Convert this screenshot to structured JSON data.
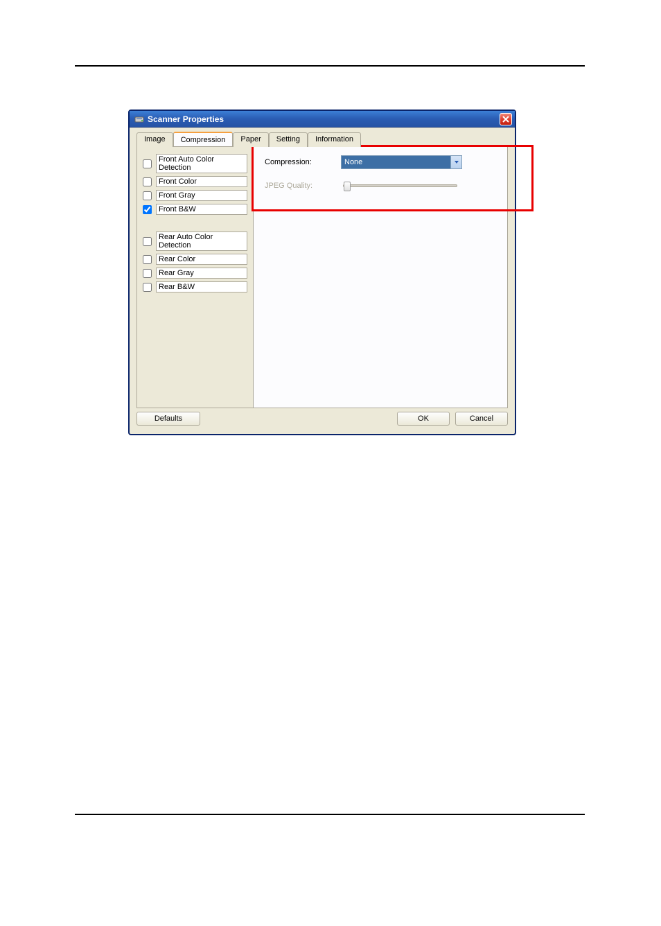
{
  "dialog": {
    "title": "Scanner Properties",
    "tabs": {
      "image": "Image",
      "compression": "Compression",
      "paper": "Paper",
      "setting": "Setting",
      "information": "Information"
    },
    "leftPane": {
      "front": {
        "autoColor": {
          "label": "Front Auto Color Detection",
          "checked": false
        },
        "color": {
          "label": "Front Color",
          "checked": false
        },
        "gray": {
          "label": "Front Gray",
          "checked": false
        },
        "bw": {
          "label": "Front B&W",
          "checked": true
        }
      },
      "rear": {
        "autoColor": {
          "label": "Rear Auto Color Detection",
          "checked": false
        },
        "color": {
          "label": "Rear Color",
          "checked": false
        },
        "gray": {
          "label": "Rear Gray",
          "checked": false
        },
        "bw": {
          "label": "Rear B&W",
          "checked": false
        }
      }
    },
    "rightPane": {
      "compressionLabel": "Compression:",
      "compressionValue": "None",
      "jpegLabel": "JPEG Quality:"
    },
    "buttons": {
      "defaults": "Defaults",
      "ok": "OK",
      "cancel": "Cancel"
    }
  }
}
